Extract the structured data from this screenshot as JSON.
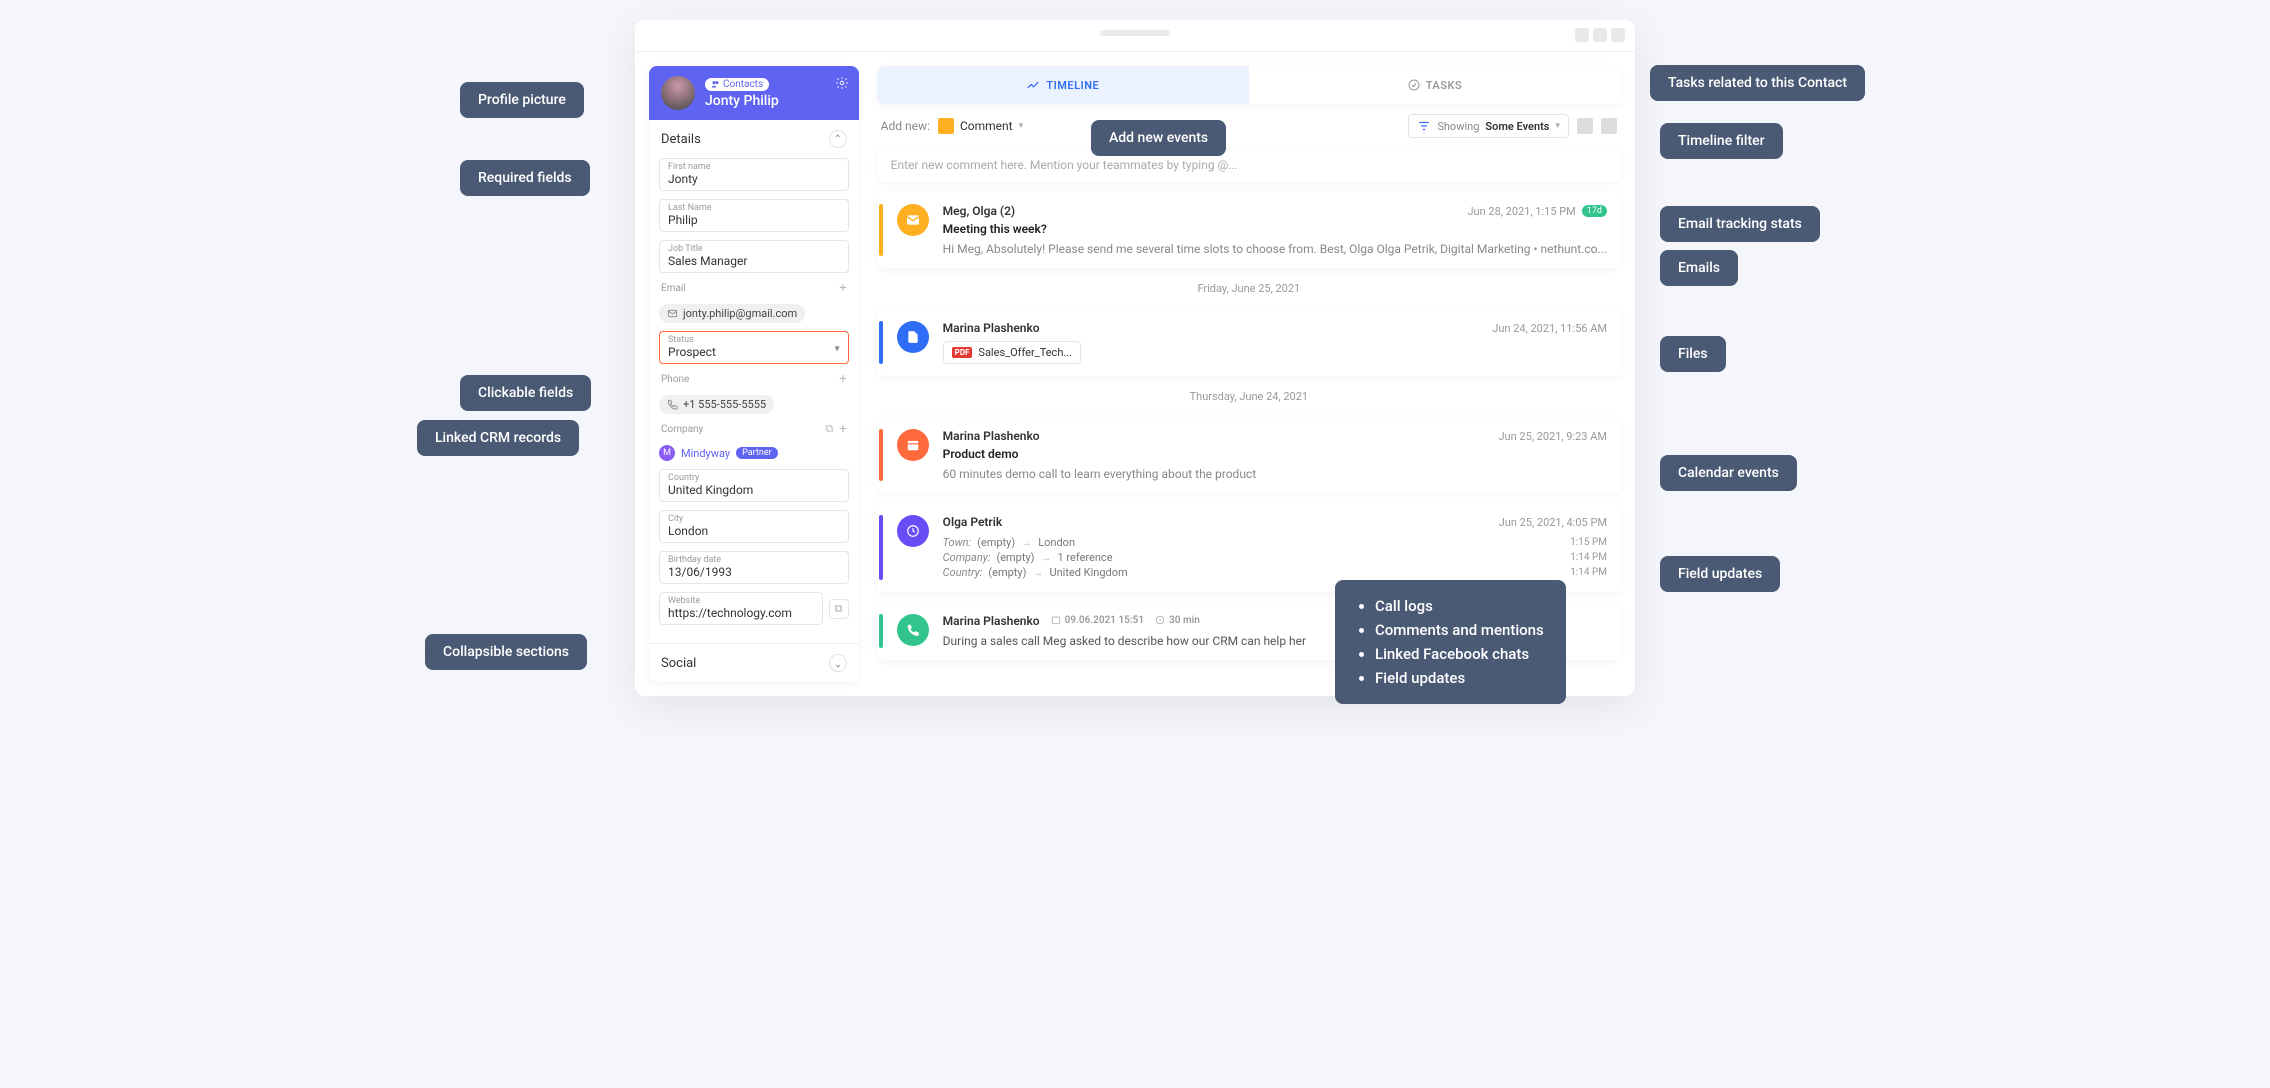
{
  "sidebar": {
    "badge_label": "Contacts",
    "name": "Jonty Philip",
    "section_details": "Details",
    "fields": {
      "first_name_lbl": "First name",
      "first_name": "Jonty",
      "last_name_lbl": "Last Name",
      "last_name": "Philip",
      "job_title_lbl": "Job Title",
      "job_title": "Sales Manager",
      "email_lbl": "Email",
      "email": "jonty.philip@gmail.com",
      "status_lbl": "Status",
      "status": "Prospect",
      "phone_lbl": "Phone",
      "phone": "+1 555-555-5555",
      "company_lbl": "Company",
      "company_initial": "M",
      "company_name": "Mindyway",
      "company_tag": "Partner",
      "country_lbl": "Country",
      "country": "United Kingdom",
      "city_lbl": "City",
      "city": "London",
      "birthday_lbl": "Birthday date",
      "birthday": "13/06/1993",
      "website_lbl": "Website",
      "website": "https://technology.com"
    },
    "section_social": "Social"
  },
  "tabs": {
    "timeline": "TIMELINE",
    "tasks": "TASKS"
  },
  "toolbar": {
    "addnew": "Add new:",
    "comment": "Comment",
    "showing": "Showing",
    "filter_value": "Some Events"
  },
  "comment_placeholder": "Enter new comment here. Mention your teammates by typing @...",
  "timeline": {
    "email": {
      "from": "Meg, Olga (2)",
      "ts": "Jun 28, 2021, 1:15 PM",
      "views": "17d",
      "subject": "Meeting this week?",
      "preview": "Hi Meg, Absolutely! Please send me several time slots to choose from. Best, Olga Olga Petrik, Digital Marketing • nethunt.co..."
    },
    "divider1": "Friday, June 25, 2021",
    "file": {
      "from": "Marina Plashenko",
      "ts": "Jun 24, 2021, 11:56 AM",
      "filename": "Sales_Offer_Tech..."
    },
    "divider2": "Thursday, June 24, 2021",
    "event": {
      "from": "Marina Plashenko",
      "ts": "Jun 25, 2021, 9:23 AM",
      "subject": "Product demo",
      "preview": "60 minutes demo call to learn everything about the product"
    },
    "update": {
      "from": "Olga Petrik",
      "ts": "Jun 25, 2021, 4:05 PM",
      "rows": [
        {
          "k": "Town:",
          "old": "(empty)",
          "new": "London",
          "t": "1:15 PM"
        },
        {
          "k": "Company:",
          "old": "(empty)",
          "new": "1 reference",
          "t": "1:14 PM"
        },
        {
          "k": "Country:",
          "old": "(empty)",
          "new": "United Kingdom",
          "t": "1:14 PM"
        }
      ]
    },
    "call": {
      "from": "Marina Plashenko",
      "date": "09.06.2021 15:51",
      "duration": "30 min",
      "preview": "During a sales call Meg asked to describe how our CRM can help her"
    }
  },
  "callouts": {
    "profile_pic": "Profile picture",
    "required": "Required fields",
    "clickable": "Clickable fields",
    "linked_crm": "Linked CRM records",
    "collapsible": "Collapsible sections",
    "add_new": "Add new events",
    "tasks": "Tasks related to this Contact",
    "filter": "Timeline filter",
    "tracking": "Email tracking stats",
    "emails": "Emails",
    "files": "Files",
    "cal": "Calendar events",
    "updates": "Field updates",
    "list": [
      "Call logs",
      "Comments and mentions",
      "Linked Facebook chats",
      "Field updates"
    ]
  }
}
